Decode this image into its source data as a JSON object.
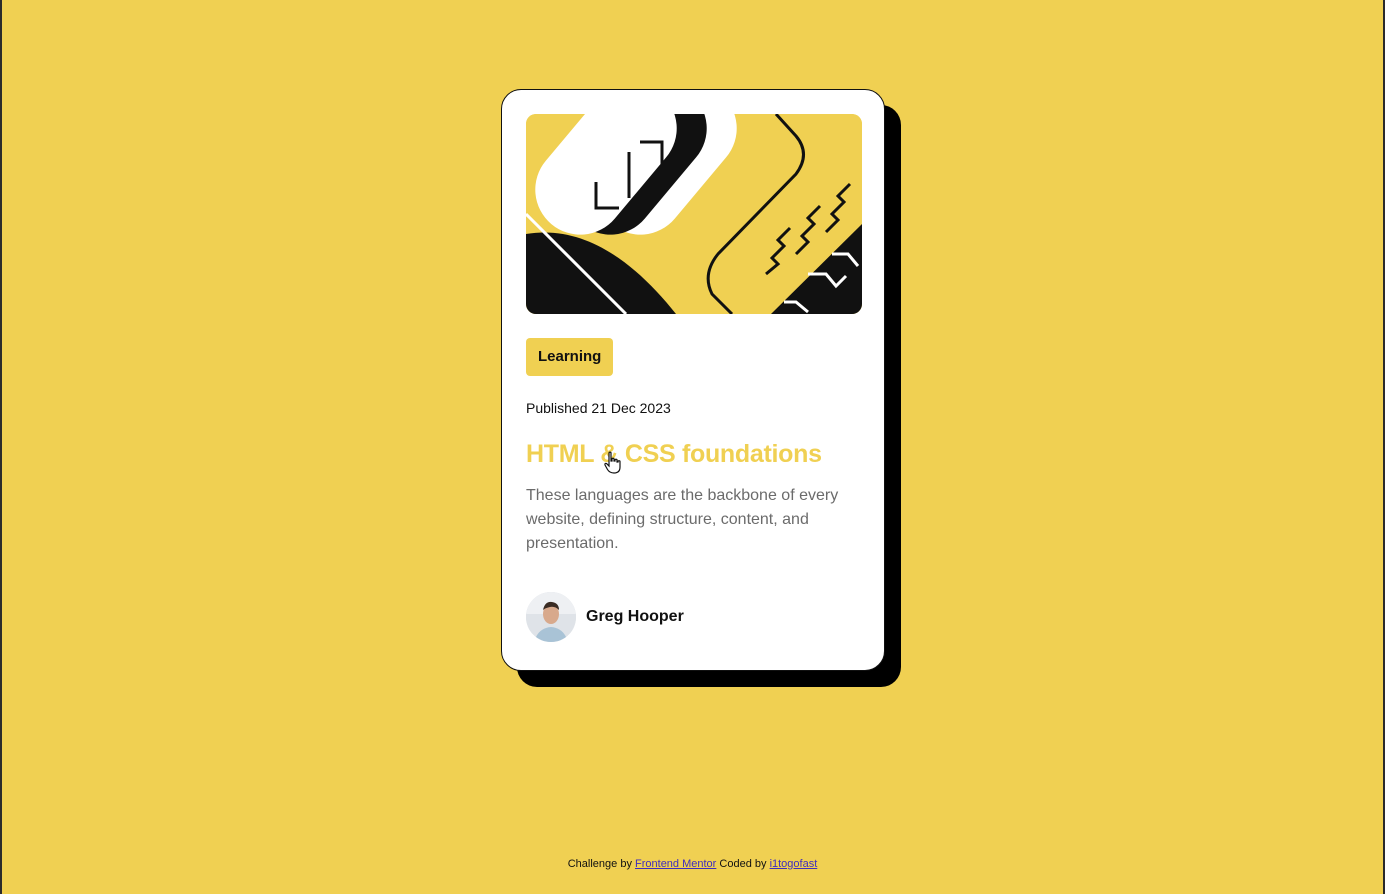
{
  "card": {
    "tag": "Learning",
    "published": "Published 21 Dec 2023",
    "title": "HTML & CSS foundations",
    "description": "These languages are the backbone of every website, defining structure, content, and presentation.",
    "author": "Greg Hooper"
  },
  "footer": {
    "prefix": "Challenge by",
    "link1": "Frontend Mentor",
    "middle": "Coded by",
    "link2": "i1togofast"
  },
  "colors": {
    "background": "#f0d052",
    "card": "#ffffff",
    "shadow": "#000000",
    "title": "#f0d052",
    "body_text": "#6b6b6b",
    "link": "#3e2dbf"
  },
  "icons": {
    "cursor": "hand-pointer-icon",
    "avatar": "avatar-photo"
  }
}
